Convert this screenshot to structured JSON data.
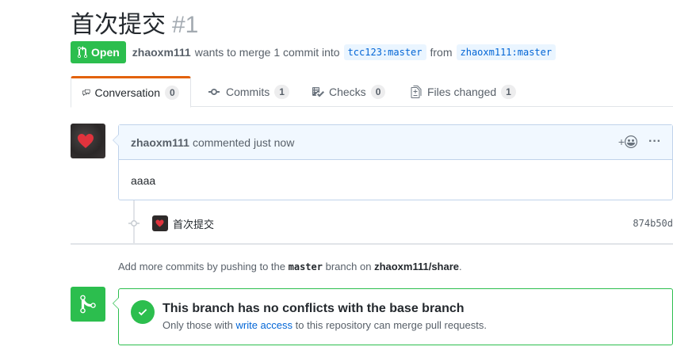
{
  "pr": {
    "title": "首次提交",
    "number": "#1",
    "state": "Open",
    "author": "zhaoxm111",
    "merge_text": "wants to merge 1 commit into",
    "base_branch": "tcc123:master",
    "from_text": "from",
    "head_branch": "zhaoxm111:master"
  },
  "tabs": [
    {
      "label": "Conversation",
      "count": "0",
      "icon": "comment-discussion-icon"
    },
    {
      "label": "Commits",
      "count": "1",
      "icon": "git-commit-icon"
    },
    {
      "label": "Checks",
      "count": "0",
      "icon": "checklist-icon"
    },
    {
      "label": "Files changed",
      "count": "1",
      "icon": "file-diff-icon"
    }
  ],
  "comment": {
    "author": "zhaoxm111",
    "action": "commented just now",
    "body": "aaaa",
    "add_reaction": "+",
    "more": "···"
  },
  "commit": {
    "message": "首次提交",
    "sha": "874b50d"
  },
  "hint": {
    "prefix": "Add more commits by pushing to the",
    "branch": "master",
    "middle": "branch on",
    "repo": "zhaoxm111/share",
    "suffix": "."
  },
  "merge": {
    "title": "This branch has no conflicts with the base branch",
    "sub_prefix": "Only those with",
    "sub_link": "write access",
    "sub_suffix": "to this repository can merge pull requests."
  },
  "colors": {
    "open_green": "#2cbe4e",
    "active_tab": "#e36209",
    "link_blue": "#0366d6"
  }
}
